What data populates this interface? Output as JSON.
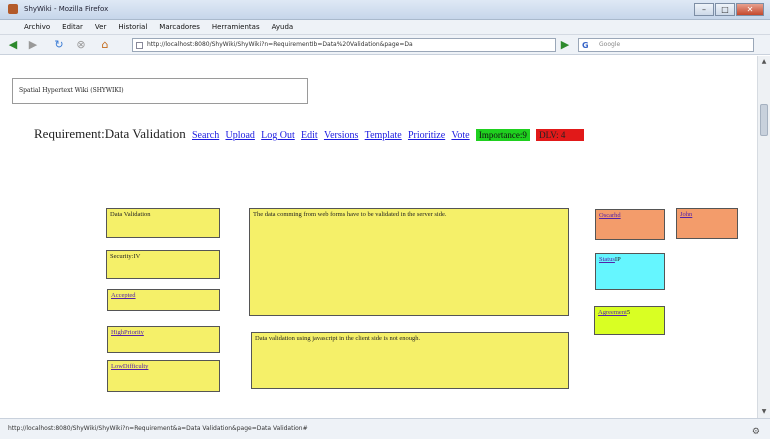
{
  "window": {
    "title": "ShyWiki - Mozilla Firefox"
  },
  "menu": [
    "Archivo",
    "Editar",
    "Ver",
    "Historial",
    "Marcadores",
    "Herramientas",
    "Ayuda"
  ],
  "nav": {
    "url": "http://localhost:8080/ShyWiki/ShyWiki?n=RequirementIb=Data%20Validation&page=Da",
    "search_placeholder": "Google"
  },
  "page": {
    "wiki_tag": "Spatial Hypertext Wiki (SHYWIKI)",
    "header": {
      "title": "Requirement:Data Validation",
      "links": [
        "Search",
        "Upload",
        "Log Out",
        "Edit",
        "Versions",
        "Template",
        "Prioritize",
        "Vote"
      ],
      "importance": "Importance:9",
      "dlv": "DLV: 4"
    },
    "left_boxes": [
      "Data Validation",
      "Security:IV",
      "Accepted",
      "HighPriority",
      "LowDifficulty"
    ],
    "description": "The data comming from web forms have to be validated in the server side.",
    "note": "Data validation using javascript in the client side is not enough.",
    "right_boxes": {
      "oscar": "Oscarhd",
      "john": "John",
      "status": "Status",
      "status_value": "IP",
      "agreement": "Agreement",
      "agreement_value": "5"
    }
  },
  "statusbar": {
    "text": "http://localhost:8080/ShyWiki/ShyWiki?n=Requirement&a=Data Validation&page=Data Validation#"
  }
}
